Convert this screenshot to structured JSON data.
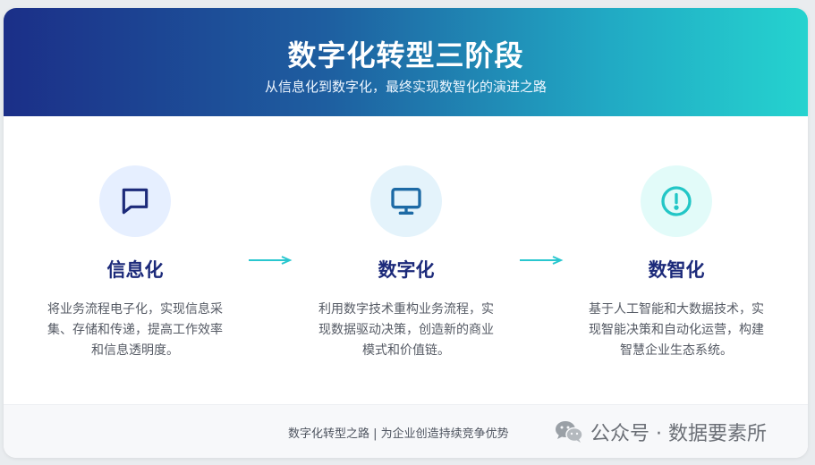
{
  "header": {
    "title": "数字化转型三阶段",
    "subtitle": "从信息化到数字化，最终实现数智化的演进之路"
  },
  "stages": [
    {
      "name": "信息化",
      "icon": "chat-bubble-icon",
      "desc_lines": [
        "将业务流程电子化，实现信息采",
        "集、存储和传递，提高工作效率",
        "和信息透明度。"
      ]
    },
    {
      "name": "数字化",
      "icon": "monitor-icon",
      "desc_lines": [
        "利用数字技术重构业务流程，实",
        "现数据驱动决策，创造新的商业",
        "模式和价值链。"
      ]
    },
    {
      "name": "数智化",
      "icon": "alert-circle-icon",
      "desc_lines": [
        "基于人工智能和大数据技术，实",
        "现智能决策和自动化运营，构建",
        "智慧企业生态系统。"
      ]
    }
  ],
  "footer": {
    "text": "数字化转型之路 | 为企业创造持续竞争优势",
    "watermark": "公众号 · 数据要素所"
  },
  "colors": {
    "gradient_start": "#1b2f88",
    "gradient_end": "#25d3cf",
    "stage_title": "#1c2a7a",
    "arrow": "#29c7cf"
  }
}
